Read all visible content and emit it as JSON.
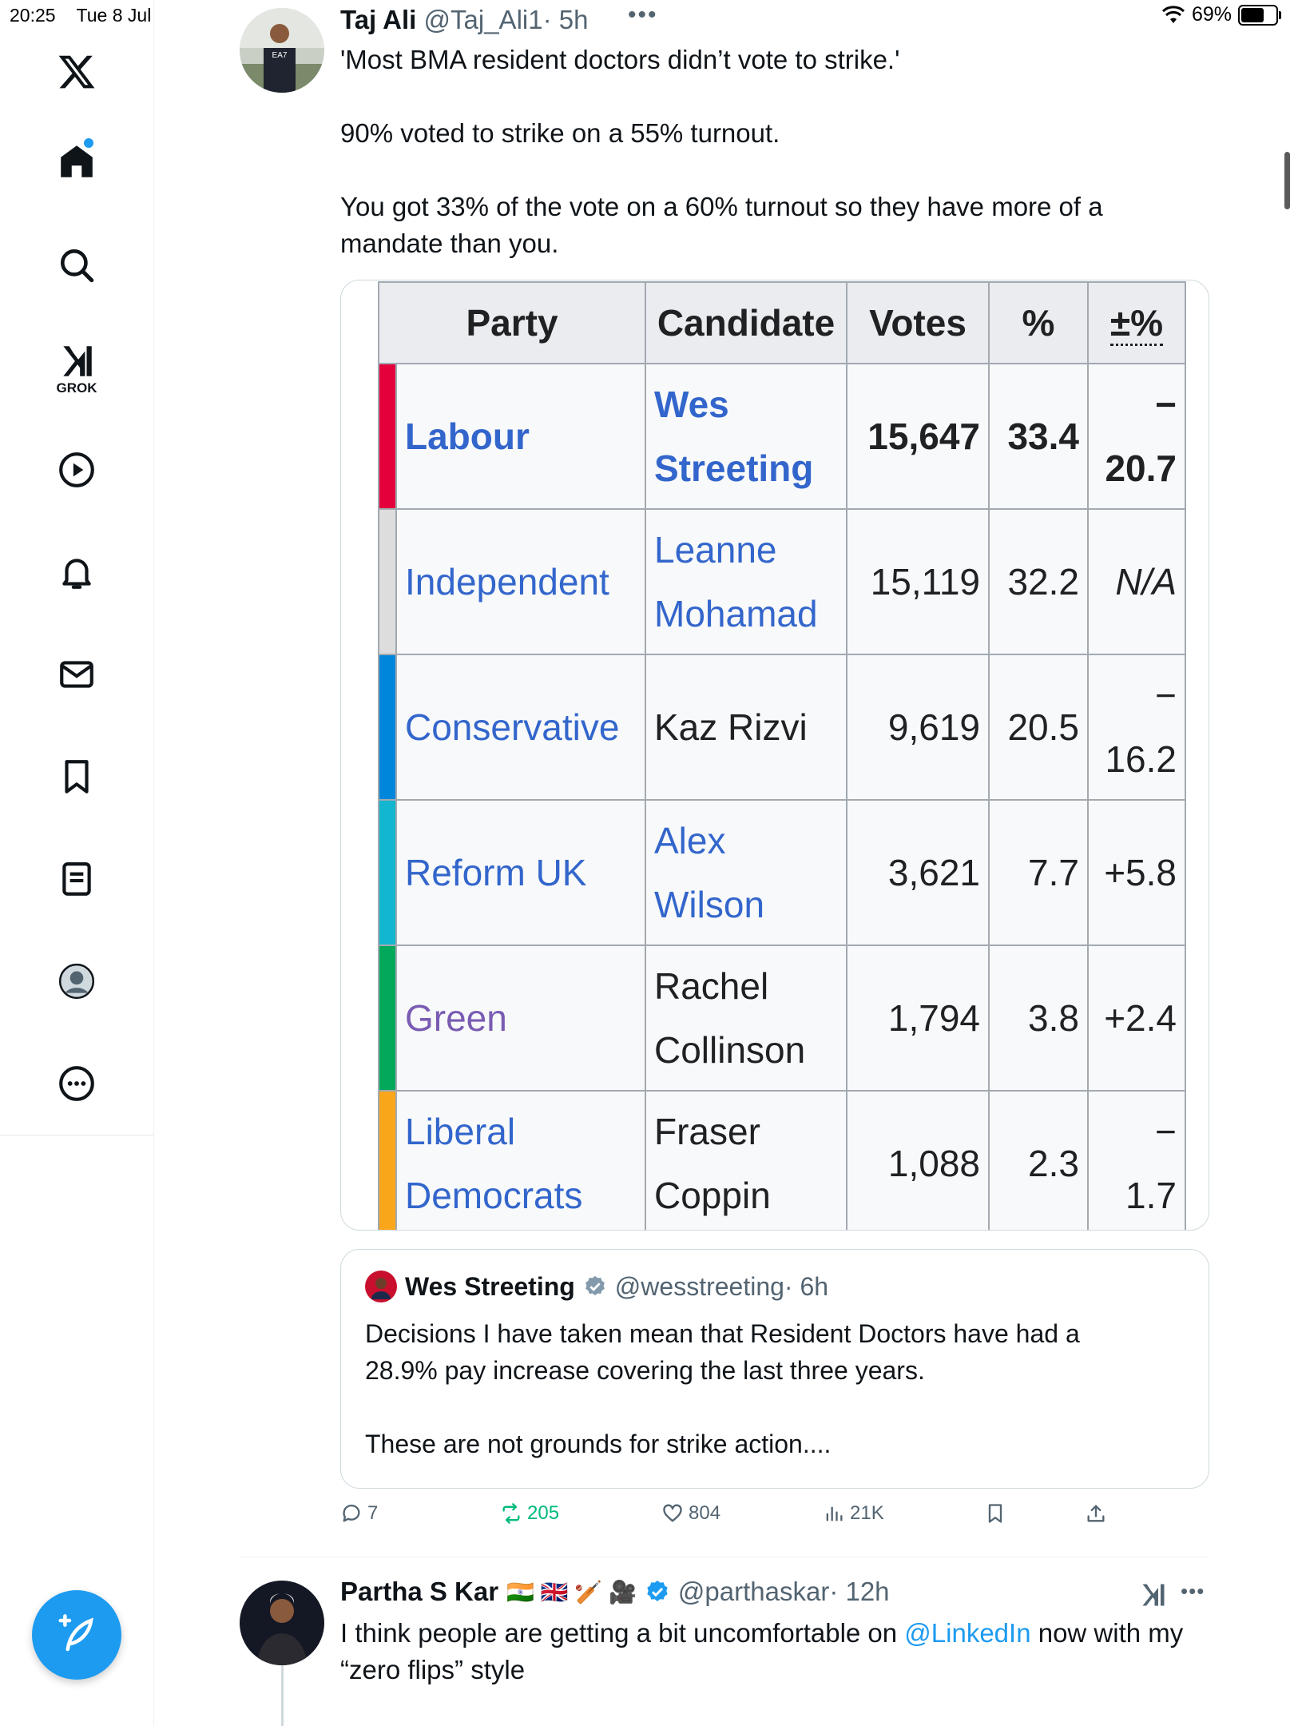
{
  "status_bar": {
    "time": "20:25",
    "date": "Tue 8 Jul",
    "battery": "69%",
    "battery_level": 0.69
  },
  "nav": {
    "grok_label": "GROK"
  },
  "tweet": {
    "author_name": "Taj Ali",
    "author_handle": "@Taj_Ali1",
    "time": "· 5h",
    "more": "•••",
    "paragraphs": [
      "'Most BMA resident doctors didn’t vote to strike.'",
      "90% voted to strike on a 55% turnout.",
      "You got 33% of the vote on a 60% turnout so they have more of a mandate than you."
    ],
    "table": {
      "headers": [
        "Party",
        "Candidate",
        "Votes",
        "%",
        "±%"
      ],
      "rows": [
        {
          "color": "#E4003B",
          "party": "Labour",
          "candidate_1": "Wes",
          "candidate_2": "Streeting",
          "votes": "15,647",
          "pct": "33.4",
          "chg_1": "−",
          "chg_2": "20.7"
        },
        {
          "color": "#DDDDDD",
          "party": "Independent",
          "candidate_1": "Leanne",
          "candidate_2": "Mohamad",
          "votes": "15,119",
          "pct": "32.2",
          "chg_1": "N/A",
          "chg_2": ""
        },
        {
          "color": "#0087DC",
          "party": "Conservative",
          "candidate_1": "Kaz Rizvi",
          "candidate_2": "",
          "votes": "9,619",
          "pct": "20.5",
          "chg_1": "−",
          "chg_2": "16.2"
        },
        {
          "color": "#12B6CF",
          "party": "Reform UK",
          "candidate_1": "Alex",
          "candidate_2": "Wilson",
          "votes": "3,621",
          "pct": "7.7",
          "chg_1": "+5.8",
          "chg_2": ""
        },
        {
          "color": "#02A95B",
          "party": "Green",
          "candidate_1": "Rachel",
          "candidate_2": "Collinson",
          "votes": "1,794",
          "pct": "3.8",
          "chg_1": "+2.4",
          "chg_2": ""
        },
        {
          "color": "#FAA61A",
          "party_1": "Liberal",
          "party_2": "Democrats",
          "candidate_1": "Fraser",
          "candidate_2": "Coppin",
          "votes": "1,088",
          "pct": "2.3",
          "chg_1": "−",
          "chg_2": "1.7"
        }
      ]
    },
    "quote": {
      "author_name": "Wes Streeting",
      "author_handle": "@wesstreeting",
      "time": "· 6h",
      "line1": "Decisions I have taken mean that Resident Doctors have had a",
      "line2": "28.9% pay increase covering the last three years.",
      "line3": "These are not grounds for strike action...."
    },
    "actions": {
      "replies": "7",
      "reposts": "205",
      "likes": "804",
      "views": "21K"
    }
  },
  "next_tweet": {
    "author_name": "Partha S Kar",
    "flags": "🇮🇳 🇬🇧 🏏 🎥",
    "author_handle": "@parthaskar",
    "time": "· 12h",
    "more": "•••",
    "text_before": "I think people are getting a bit uncomfortable on ",
    "mention": "@LinkedIn",
    "text_after": " now with my “zero flips” style"
  },
  "colors": {
    "accent": "#1d9bf0",
    "repost_green": "#00ba7c",
    "wiki_link": "#3366cc",
    "wiki_visited": "#795cb2"
  }
}
